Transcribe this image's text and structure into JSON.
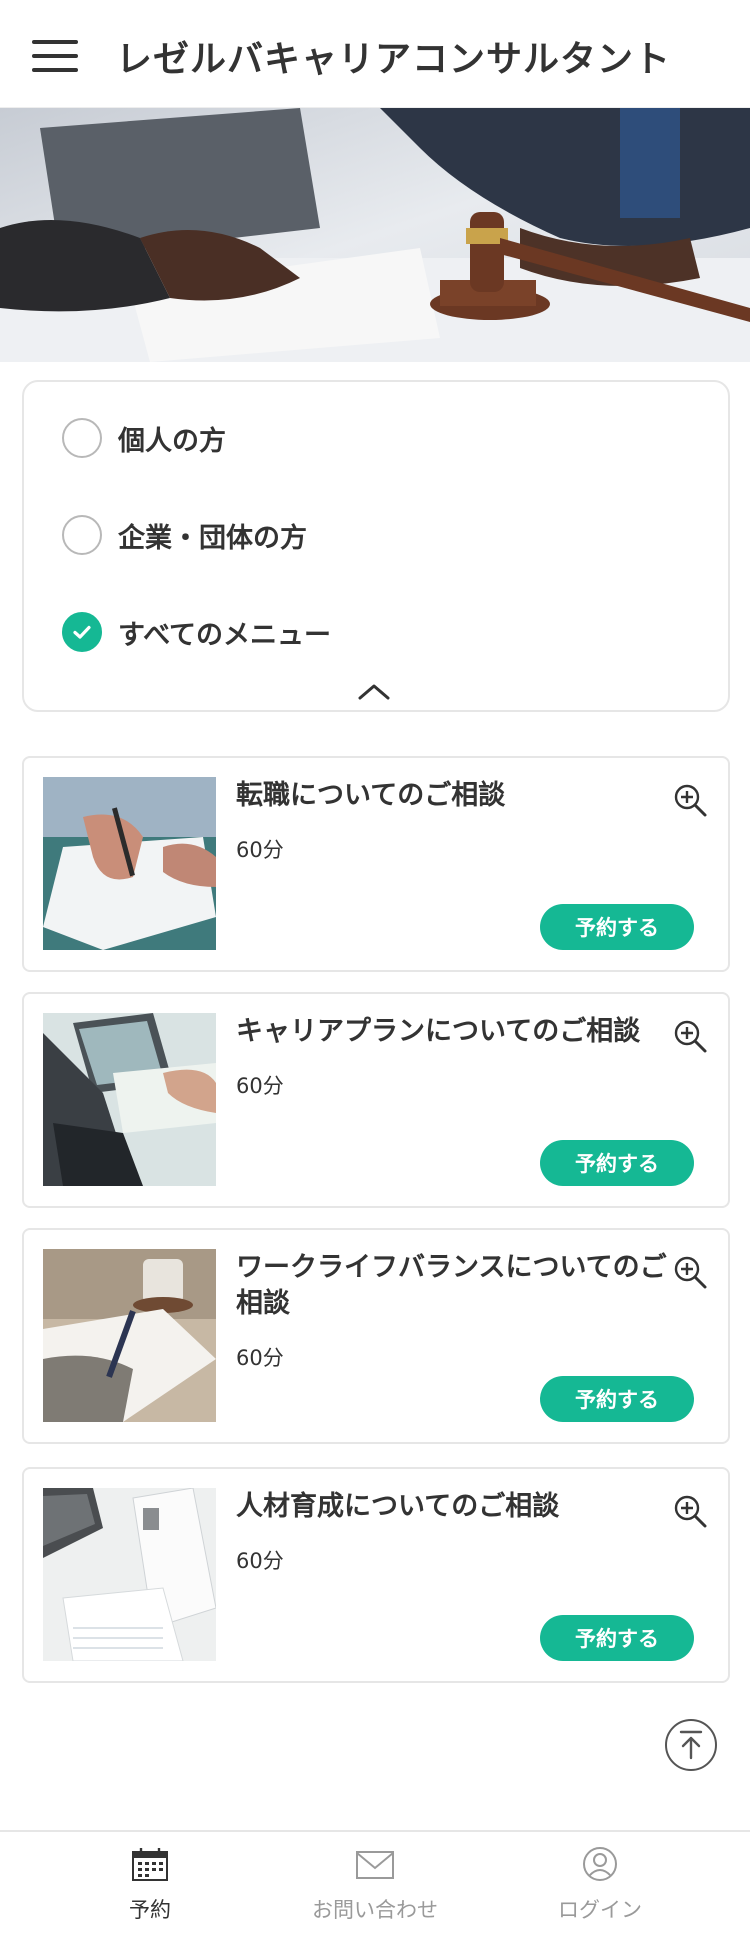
{
  "header": {
    "menu_icon": "hamburger-menu-icon",
    "title": "レゼルバキャリアコンサルタント"
  },
  "hero": {
    "image": "hero-image-business-meeting-with-gavel"
  },
  "filters": {
    "options": [
      {
        "label": "個人の方",
        "checked": false
      },
      {
        "label": "企業・団体の方",
        "checked": false
      },
      {
        "label": "すべてのメニュー",
        "checked": true
      }
    ],
    "collapse_icon": "chevron-up-icon"
  },
  "menus": [
    {
      "title": "転職についてのご相談",
      "duration": "60分",
      "button": "予約する",
      "image": "writing-document-photo"
    },
    {
      "title": "キャリアプランについてのご相談",
      "duration": "60分",
      "button": "予約する",
      "image": "laptop-desk-photo"
    },
    {
      "title": "ワークライフバランスについてのご相談",
      "duration": "60分",
      "button": "予約する",
      "image": "notebook-coffee-photo"
    },
    {
      "title": "人材育成についてのご相談",
      "duration": "60分",
      "button": "予約する",
      "image": "papers-laptop-photo"
    }
  ],
  "bottom_nav": {
    "items": [
      {
        "label": "予約",
        "icon": "calendar-icon",
        "active": true
      },
      {
        "label": "お問い合わせ",
        "icon": "mail-icon",
        "active": false
      },
      {
        "label": "ログイン",
        "icon": "user-icon",
        "active": false
      }
    ]
  },
  "colors": {
    "accent": "#15b894",
    "text": "#333333",
    "border": "#e6e6e6",
    "inactive_nav": "#9a9a9a"
  }
}
